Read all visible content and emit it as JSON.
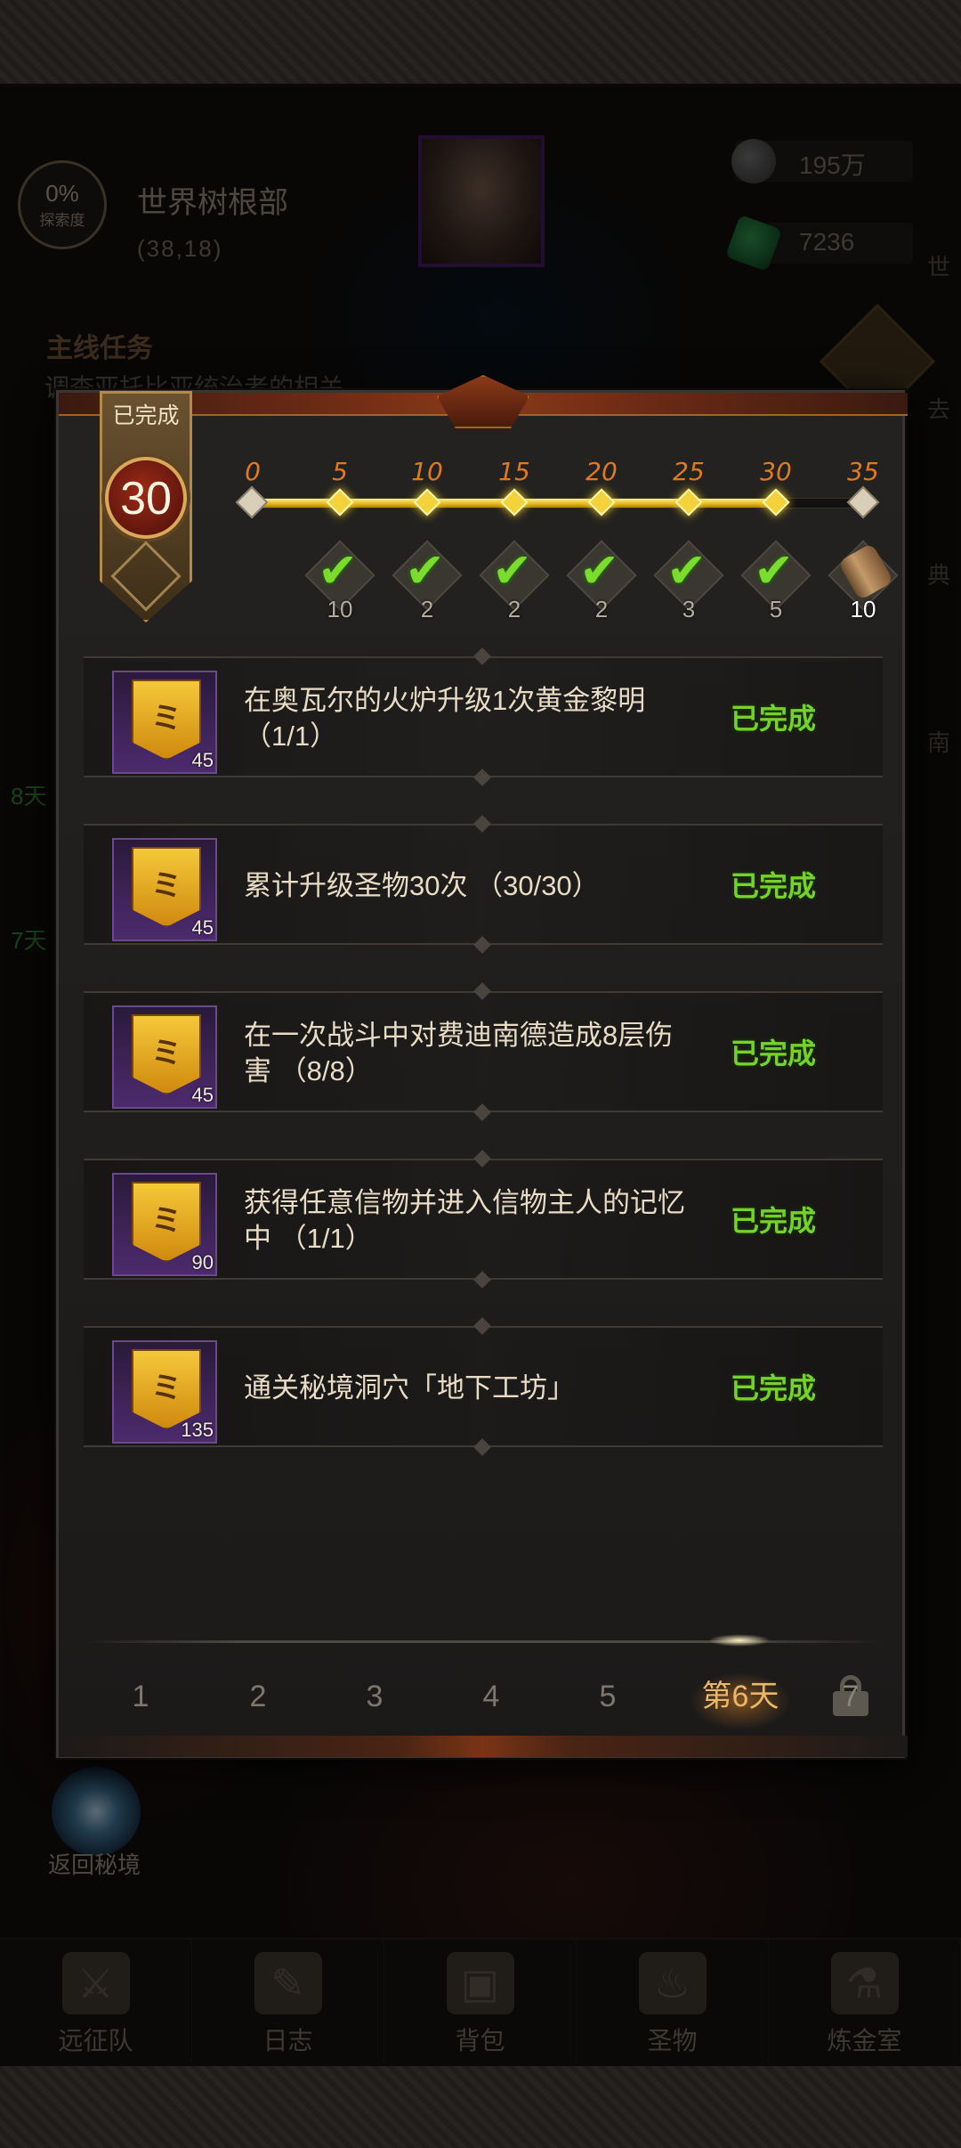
{
  "background": {
    "explore_percent": "0%",
    "explore_label": "探索度",
    "location_name": "世界树根部",
    "location_coords": "(38,18)",
    "currency_1": "195万",
    "currency_2": "7236",
    "main_quest_title": "主线任务",
    "main_quest_text": "调查亚托比亚统治者的相关",
    "side_days": [
      "8天",
      "7天"
    ],
    "right_edge_labels": [
      "世",
      "去",
      "典",
      "南"
    ],
    "return_label": "返回秘境"
  },
  "bottom_nav": [
    {
      "label": "远征队",
      "icon": "helmet-icon",
      "glyph": "⚔"
    },
    {
      "label": "日志",
      "icon": "journal-icon",
      "glyph": "✎"
    },
    {
      "label": "背包",
      "icon": "backpack-icon",
      "glyph": "▣"
    },
    {
      "label": "圣物",
      "icon": "relic-icon",
      "glyph": "♨"
    },
    {
      "label": "炼金室",
      "icon": "alchemy-icon",
      "glyph": "⚗"
    }
  ],
  "modal": {
    "banner_status": "已完成",
    "level": "30",
    "milestones": [
      "0",
      "5",
      "10",
      "15",
      "20",
      "25",
      "30",
      "35"
    ],
    "progress": 0.857,
    "rewards": [
      {
        "qty": "10",
        "claimed": true
      },
      {
        "qty": "2",
        "claimed": true
      },
      {
        "qty": "2",
        "claimed": true
      },
      {
        "qty": "2",
        "claimed": true
      },
      {
        "qty": "3",
        "claimed": true
      },
      {
        "qty": "5",
        "claimed": true
      },
      {
        "qty": "10",
        "claimed": false
      }
    ],
    "tasks": [
      {
        "text": "在奥瓦尔的火炉升级1次黄金黎明（1/1）",
        "points": "45",
        "status": "已完成"
      },
      {
        "text": "累计升级圣物30次 （30/30）",
        "points": "45",
        "status": "已完成"
      },
      {
        "text": "在一次战斗中对费迪南德造成8层伤害 （8/8）",
        "points": "45",
        "status": "已完成"
      },
      {
        "text": "获得任意信物并进入信物主人的记忆中 （1/1）",
        "points": "90",
        "status": "已完成"
      },
      {
        "text": "通关秘境洞穴「地下工坊」",
        "points": "135",
        "status": "已完成"
      }
    ],
    "day_tabs": [
      "1",
      "2",
      "3",
      "4",
      "5",
      "第6天",
      "7"
    ],
    "active_tab": 5,
    "locked_tab": 6
  },
  "colors": {
    "accent_orange": "#e07a1e",
    "complete_green": "#76d12b",
    "gold": "#e2b516"
  }
}
